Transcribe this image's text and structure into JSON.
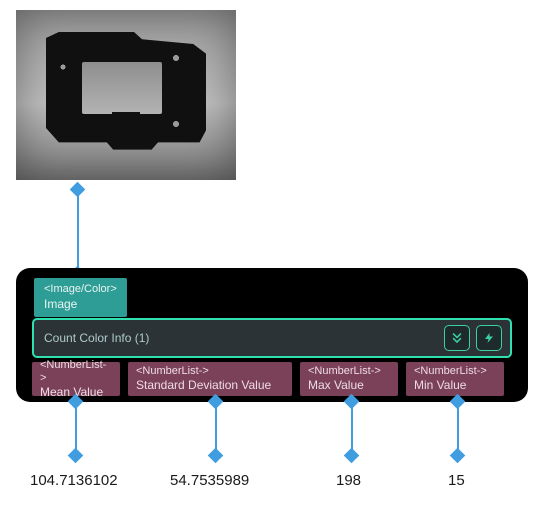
{
  "thumbnail": {
    "semantic": "grayscale-part-photo"
  },
  "node": {
    "input": {
      "type": "<Image/Color>",
      "label": "Image"
    },
    "title": "Count Color Info (1)",
    "buttons": {
      "expand_icon": "chevrons-down",
      "run_icon": "bolt"
    },
    "outputs": [
      {
        "type": "<NumberList->",
        "label": "Mean Value"
      },
      {
        "type": "<NumberList->",
        "label": "Standard Deviation Value"
      },
      {
        "type": "<NumberList->",
        "label": "Max Value"
      },
      {
        "type": "<NumberList->",
        "label": "Min Value"
      }
    ]
  },
  "values": {
    "mean": "104.7136102",
    "stddev": "54.7535989",
    "max": "198",
    "min": "15"
  },
  "colors": {
    "teal": "#2e9d95",
    "mint": "#2fe0b0",
    "plum": "#7a4159",
    "link": "#3f9de0"
  }
}
